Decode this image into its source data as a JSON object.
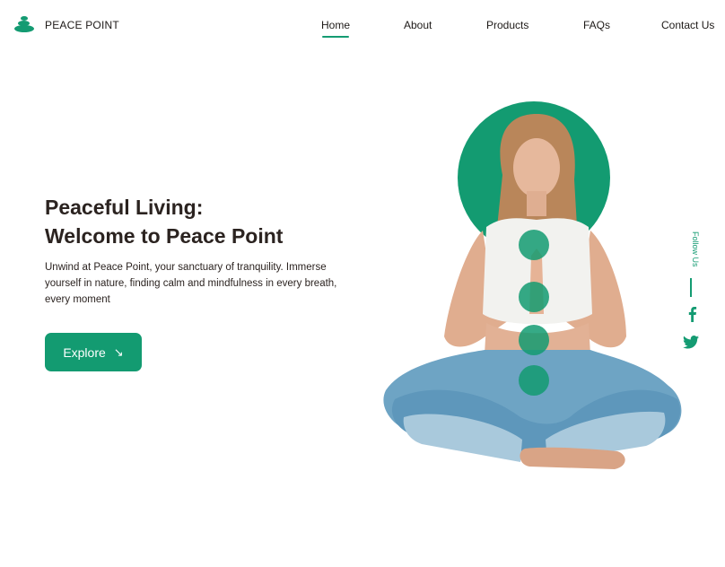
{
  "brand": {
    "name": "PEACE POINT",
    "logo_icon": "stacked-stones-icon"
  },
  "nav": {
    "items": [
      {
        "label": "Home",
        "active": true
      },
      {
        "label": "About",
        "active": false
      },
      {
        "label": "Products",
        "active": false
      },
      {
        "label": "FAQs",
        "active": false
      },
      {
        "label": "Contact Us",
        "active": false
      }
    ]
  },
  "hero": {
    "title_line1": "Peaceful Living:",
    "title_line2": "Welcome to Peace Point",
    "description": "Unwind at Peace Point, your sanctuary of tranquility. Immerse yourself in nature, finding calm and mindfulness in every breath, every moment",
    "cta_label": "Explore",
    "cta_icon": "arrow-down-right-icon"
  },
  "social": {
    "label": "Follow Us",
    "icons": [
      "facebook-icon",
      "twitter-icon"
    ]
  },
  "colors": {
    "accent": "#149b72",
    "text": "#2b2320",
    "background": "#ffffff"
  }
}
